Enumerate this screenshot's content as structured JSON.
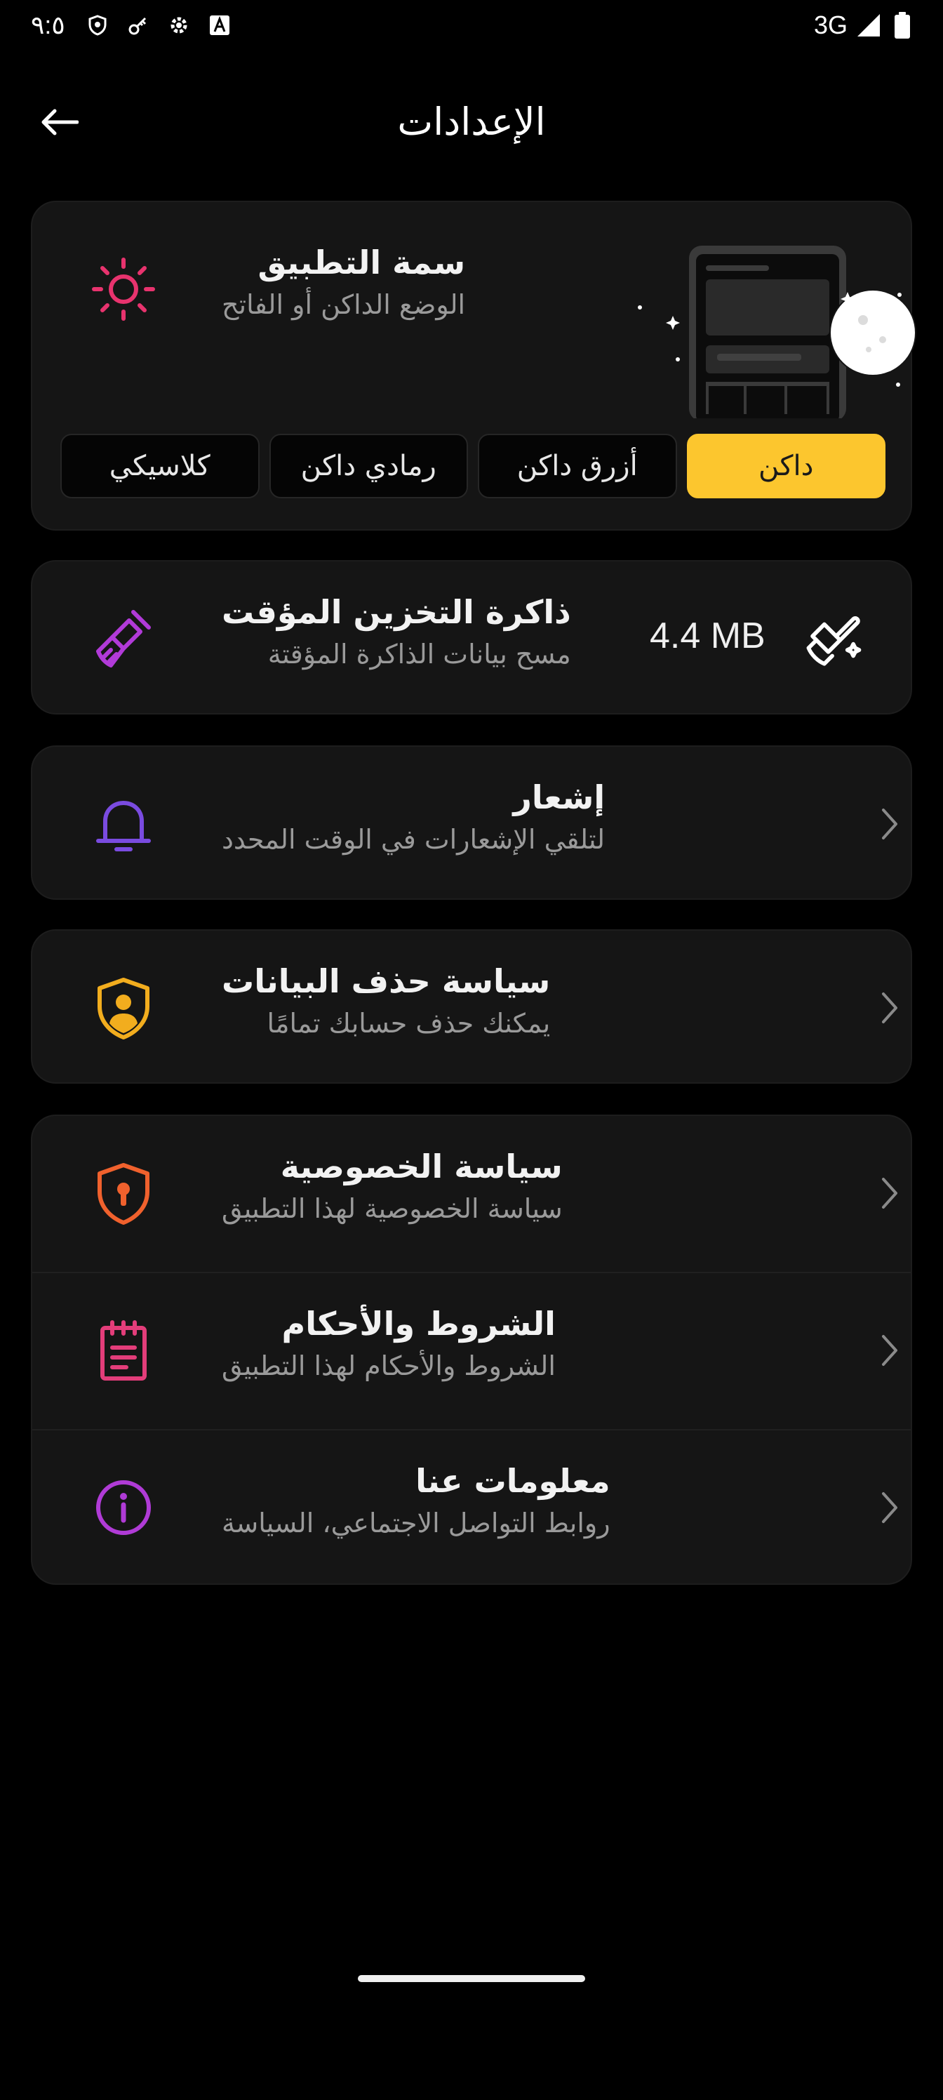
{
  "status_bar": {
    "time": "٩:٥",
    "network": "3G",
    "icons": [
      "shield-icon",
      "vpn-key-icon",
      "settings-gear-icon",
      "font-a-icon",
      "signal-icon",
      "battery-icon"
    ]
  },
  "header": {
    "title": "الإعدادات",
    "back_icon": "arrow-back-icon"
  },
  "theme": {
    "title": "سمة التطبيق",
    "subtitle": "الوضع الداكن أو الفاتح",
    "options": [
      "داكن",
      "أزرق داكن",
      "رمادي داكن",
      "كلاسيكي"
    ],
    "selected": "داكن",
    "icon": "sun-icon",
    "accent_color": "#fcc62e",
    "icon_color": "#e8336e"
  },
  "cache": {
    "title": "ذاكرة التخزين المؤقت",
    "subtitle": "مسح بيانات الذاكرة المؤقتة",
    "size": "4.4 MB",
    "icon": "broom-icon",
    "icon_color": "#b13ad8"
  },
  "notification": {
    "title": "إشعار",
    "subtitle": "لتلقي الإشعارات في الوقت المحدد",
    "icon": "bell-icon",
    "icon_color": "#7a4be0"
  },
  "data_deletion": {
    "title": "سياسة حذف البيانات",
    "subtitle": "يمكنك حذف حسابك تمامًا",
    "icon": "user-shield-icon",
    "icon_color": "#f2ad1e"
  },
  "links": [
    {
      "title": "سياسة الخصوصية",
      "subtitle": "سياسة الخصوصية لهذا التطبيق",
      "icon": "lock-shield-icon",
      "icon_color": "#f0612d"
    },
    {
      "title": "الشروط والأحكام",
      "subtitle": "الشروط والأحكام لهذا التطبيق",
      "icon": "clipboard-icon",
      "icon_color": "#e33d7a"
    },
    {
      "title": "معلومات عنا",
      "subtitle": "روابط التواصل الاجتماعي، السياسة",
      "icon": "info-icon",
      "icon_color": "#b03bd6"
    }
  ]
}
